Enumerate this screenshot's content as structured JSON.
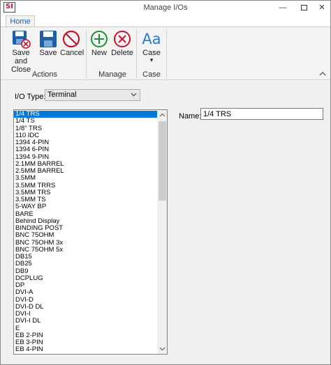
{
  "window": {
    "title": "Manage I/Os",
    "logo_text": "SI",
    "minimize_glyph": "—",
    "close_glyph": "✕"
  },
  "ribbon": {
    "tabs": [
      {
        "label": "Home"
      }
    ],
    "groups": {
      "actions": {
        "label": "Actions",
        "buttons": {
          "save_close": {
            "label_line1": "Save and",
            "label_line2": "Close",
            "icon": "save-and-close-icon"
          },
          "save": {
            "label": "Save",
            "icon": "floppy-disk-icon"
          },
          "cancel": {
            "label": "Cancel",
            "icon": "cancel-circle-icon"
          }
        }
      },
      "manage": {
        "label": "Manage",
        "buttons": {
          "new": {
            "label": "New",
            "icon": "plus-circle-icon"
          },
          "delete": {
            "label": "Delete",
            "icon": "x-circle-icon"
          }
        }
      },
      "case": {
        "label": "Case",
        "buttons": {
          "case": {
            "label": "Case",
            "icon_text": "Aa",
            "dropdown_glyph": "▾"
          }
        }
      }
    }
  },
  "io_type": {
    "label": "I/O Type:",
    "selected": "Terminal"
  },
  "io_list": {
    "selected_index": 0,
    "items": [
      "1/4 TRS",
      "1/4 TS",
      "1/8\" TRS",
      "110 IDC",
      "1394 4-PIN",
      "1394 6-PIN",
      "1394 9-PIN",
      "2.1MM BARREL",
      "2.5MM BARREL",
      "3.5MM",
      "3.5MM TRRS",
      "3.5MM TRS",
      "3.5MM TS",
      "5-WAY BP",
      "BARE",
      "Behind Display",
      "BINDING POST",
      "BNC 75OHM",
      "BNC 75OHM 3x",
      "BNC 75OHM 5x",
      "DB15",
      "DB25",
      "DB9",
      "DCPLUG",
      "DP",
      "DVI-A",
      "DVI-D",
      "DVI-D DL",
      "DVI-I",
      "DVI-I DL",
      "E",
      "EB 2-PIN",
      "EB 3-PIN",
      "EB 4-PIN"
    ]
  },
  "name_field": {
    "label": "Name:",
    "value": "1/4 TRS"
  },
  "colors": {
    "selection": "#0078d7",
    "save_blue": "#1f5fa8",
    "cancel_red": "#c8102e",
    "new_green": "#1e8c3a",
    "case_blue": "#2a7bd0"
  }
}
